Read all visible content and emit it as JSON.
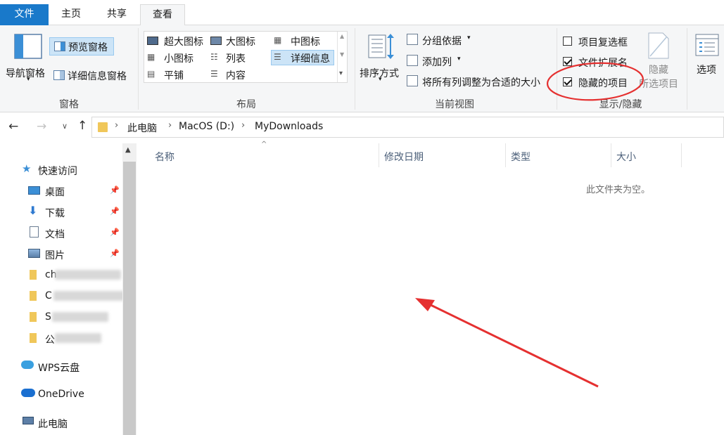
{
  "tabs": {
    "file": "文件",
    "home": "主页",
    "share": "共享",
    "view": "查看"
  },
  "panes": {
    "nav_pane": "导航窗格",
    "preview_pane": "预览窗格",
    "details_pane": "详细信息窗格",
    "group_label": "窗格"
  },
  "layout": {
    "items": [
      "超大图标",
      "大图标",
      "中图标",
      "小图标",
      "列表",
      "详细信息",
      "平铺",
      "内容"
    ],
    "group_label": "布局"
  },
  "current_view": {
    "sort_by": "排序方式",
    "group_by": "分组依据",
    "add_columns": "添加列",
    "size_columns": "将所有列调整为合适的大小",
    "group_label": "当前视图"
  },
  "show_hide": {
    "item_checkboxes": "项目复选框",
    "file_extensions": "文件扩展名",
    "hidden_items": "隐藏的项目",
    "hide_selected_line1": "隐藏",
    "hide_selected_line2": "所选项目",
    "group_label": "显示/隐藏",
    "item_checkboxes_checked": false,
    "file_extensions_checked": true,
    "hidden_items_checked": true
  },
  "options": {
    "label": "选项"
  },
  "address": {
    "crumbs": [
      "此电脑",
      "MacOS (D:)",
      "MyDownloads"
    ]
  },
  "nav": {
    "quick_access": "快速访问",
    "desktop": "桌面",
    "downloads": "下载",
    "documents": "文档",
    "pictures": "图片",
    "folder1": "ch",
    "folder2": "C",
    "folder3": "S",
    "folder4": "公",
    "wps": "WPS云盘",
    "onedrive": "OneDrive",
    "this_pc": "此电脑"
  },
  "columns": {
    "name": "名称",
    "modified": "修改日期",
    "type": "类型",
    "size": "大小"
  },
  "empty_message": "此文件夹为空。",
  "colors": {
    "accent": "#1979ca",
    "annotation": "#e53030"
  }
}
